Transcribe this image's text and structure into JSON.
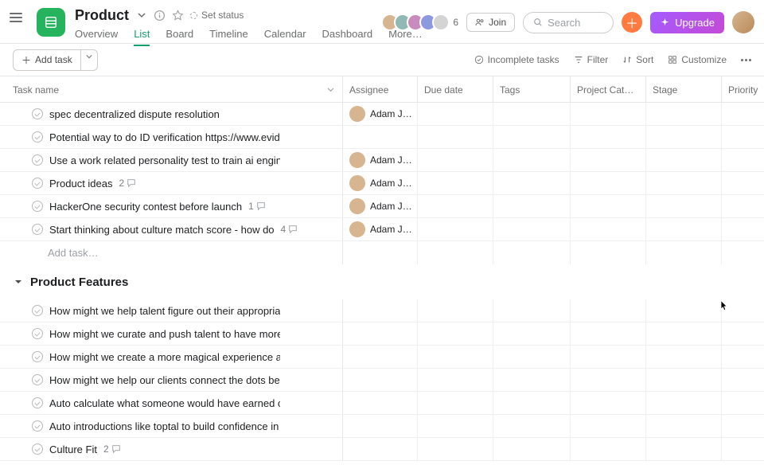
{
  "project": {
    "title": "Product",
    "status_label": "Set status"
  },
  "tabs": {
    "overview": "Overview",
    "list": "List",
    "board": "Board",
    "timeline": "Timeline",
    "calendar": "Calendar",
    "dashboard": "Dashboard",
    "more": "More…"
  },
  "header": {
    "join": "Join",
    "search_placeholder": "Search",
    "upgrade": "Upgrade",
    "member_count": "6",
    "avatar_colors": [
      "#d6b590",
      "#8fb9b2",
      "#c98bbd",
      "#8b9adf",
      "#d4d4d4"
    ]
  },
  "toolbar": {
    "add_task": "Add task",
    "incomplete": "Incomplete tasks",
    "filter": "Filter",
    "sort": "Sort",
    "customize": "Customize"
  },
  "columns": {
    "name": "Task name",
    "assignee": "Assignee",
    "due": "Due date",
    "tags": "Tags",
    "cat": "Project Cat…",
    "stage": "Stage",
    "prio": "Priority"
  },
  "assignee_name": "Adam Jack…",
  "assignee_color": "#d6b590",
  "rows": [
    {
      "name": "spec decentralized dispute resolution",
      "assignee": true,
      "comments": null
    },
    {
      "name": "Potential way to do ID verification https://www.evidentid",
      "assignee": false,
      "comments": null
    },
    {
      "name": "Use a work related personality test to train ai engine tha",
      "assignee": true,
      "comments": null
    },
    {
      "name": "Product ideas",
      "assignee": true,
      "comments": 2
    },
    {
      "name": "HackerOne security contest before launch",
      "assignee": true,
      "comments": 1
    },
    {
      "name": "Start thinking about culture match score - how do",
      "assignee": true,
      "comments": 4
    }
  ],
  "add_task_inline": "Add task…",
  "section": {
    "title": "Product Features"
  },
  "rows2": [
    {
      "name": "How might we help talent figure out their appropriate ra",
      "comments": null
    },
    {
      "name": "How might we curate and push talent to have more prof",
      "comments": null
    },
    {
      "name": "How might we create a more magical experience arounc",
      "comments": null
    },
    {
      "name": "How might we help our clients connect the dots betwee",
      "comments": null
    },
    {
      "name": "Auto calculate what someone would have earned on bra",
      "comments": null
    },
    {
      "name": "Auto introductions like toptal to build confidence in freel",
      "comments": null
    },
    {
      "name": "Culture Fit",
      "comments": 2
    }
  ]
}
